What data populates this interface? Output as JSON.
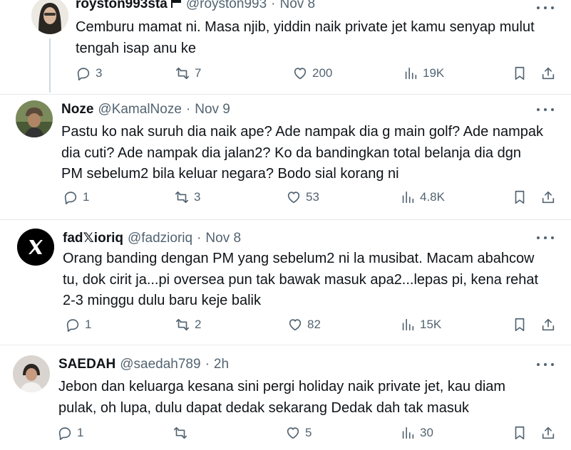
{
  "tweets": [
    {
      "name": "royston993sta",
      "flag_icon": "flag-icon",
      "handle": "@royston993",
      "dot": "·",
      "time": "Nov 8",
      "lines": [
        "Cemburu mamat ni. Masa njib, yiddin naik private jet kamu senyap mulut",
        "tengah isap anu ke"
      ],
      "reply_count": "3",
      "retweet_count": "7",
      "like_count": "200",
      "view_count": "19K"
    },
    {
      "name": "Noze",
      "handle": "@KamalNoze",
      "dot": "·",
      "time": "Nov 9",
      "lines": [
        "Pastu ko nak suruh dia naik ape? Ade nampak dia g main golf? Ade nampak",
        "dia cuti? Ade nampak dia jalan2? Ko da bandingkan total belanja dia dgn",
        "PM sebelum2 bila keluar negara? Bodo sial korang ni"
      ],
      "reply_count": "1",
      "retweet_count": "3",
      "like_count": "53",
      "view_count": "4.8K"
    },
    {
      "name": "fad𝕏ioriq",
      "handle": "@fadzioriq",
      "dot": "·",
      "time": "Nov 8",
      "lines": [
        "Orang banding dengan PM yang sebelum2 ni la musibat. Macam abahcow",
        "tu, dok cirit ja...pi oversea pun tak bawak masuk apa2...lepas pi, kena rehat",
        "2-3 minggu dulu baru keje balik"
      ],
      "reply_count": "1",
      "retweet_count": "2",
      "like_count": "82",
      "view_count": "15K"
    },
    {
      "name": "SAEDAH",
      "handle": "@saedah789",
      "dot": "·",
      "time": "2h",
      "lines": [
        "Jebon dan keluarga kesana sini pergi holiday naik private jet, kau diam",
        "pulak, oh lupa, dulu dapat dedak sekarang Dedak dah tak masuk"
      ],
      "reply_count": "1",
      "retweet_count": "",
      "like_count": "5",
      "view_count": "30"
    }
  ],
  "icons": {
    "reply": "reply-icon",
    "retweet": "retweet-icon",
    "like": "heart-icon",
    "views": "views-icon",
    "bookmark": "bookmark-icon",
    "share": "share-icon",
    "more": "more-icon"
  },
  "colors": {
    "text": "#0f1419",
    "secondary": "#536471",
    "divider": "#e7e9ea"
  }
}
